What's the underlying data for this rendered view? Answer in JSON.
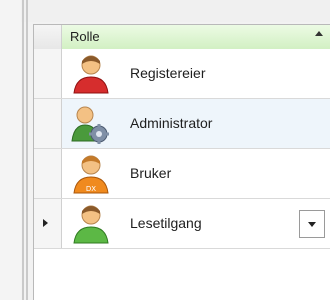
{
  "grid": {
    "column_header": "Rolle",
    "sort_icon": "sort-ascending-icon",
    "rows": [
      {
        "label": "Registereier",
        "icon": "user-red-icon"
      },
      {
        "label": "Administrator",
        "icon": "users-gear-icon"
      },
      {
        "label": "Bruker",
        "icon": "user-dx-icon"
      },
      {
        "label": "Lesetilgang",
        "icon": "user-green-icon"
      }
    ],
    "current_row_icon": "current-row-indicator-icon",
    "dropdown_icon": "dropdown-arrow-icon"
  },
  "colors": {
    "header_green": "#d2f0c3",
    "selected_row": "#eef5fb"
  }
}
